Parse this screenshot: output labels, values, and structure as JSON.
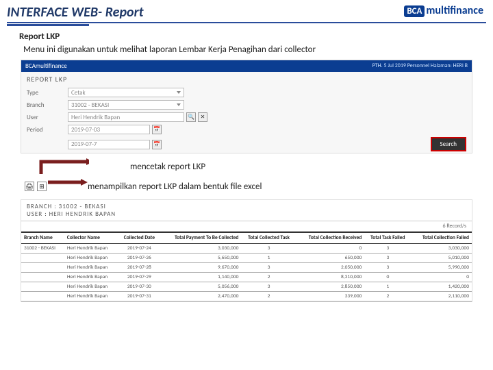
{
  "title": "INTERFACE WEB- Report",
  "logo": {
    "bca": "BCA",
    "multifinance": "multifinance"
  },
  "subtitle": "Report LKP",
  "desc": "Menu ini digunakan untuk melihat laporan Lembar Kerja Penagihan dari collector",
  "shot1": {
    "topbar_brand": "BCAmultifinance",
    "topbar_right": "PTH. 5 Jul 2019\nPersonnel Halaman: HERI B",
    "header": "REPORT LKP",
    "fields": {
      "type_label": "Type",
      "type_value": "Cetak",
      "branch_label": "Branch",
      "branch_value": "31002 - BEKASI",
      "user_label": "User",
      "user_value": "Heri Hendrik Bapan",
      "period_label": "Period",
      "period_from": "2019-07-03",
      "period_to": "2019-07-7"
    },
    "search": "Search"
  },
  "callouts": {
    "c1": "mencetak report LKP",
    "c2": "menampilkan report LKP dalam bentuk file excel"
  },
  "shot2": {
    "branch_line": "BRANCH : 31002 - BEKASI",
    "user_line": "USER : HERI HENDRIK BAPAN",
    "records": "6 Record/s",
    "headers": [
      "Branch Name",
      "Collector Name",
      "Collected Date",
      "Total Payment To Be Collected",
      "Total Collected Task",
      "Total Collection Received",
      "Total Task Failed",
      "Total Collection Failed"
    ],
    "rows": [
      [
        "31002 - BEKASI",
        "Heri Hendrik Bapan",
        "2019-07-24",
        "3,030,000",
        "3",
        "0",
        "3",
        "3,030,000"
      ],
      [
        "",
        "Heri Hendrik Bapan",
        "2019-07-26",
        "5,650,000",
        "1",
        "650,000",
        "3",
        "5,010,000"
      ],
      [
        "",
        "Heri Hendrik Bapan",
        "2019-07-28",
        "9,670,000",
        "3",
        "2,050,000",
        "3",
        "5,990,000"
      ],
      [
        "",
        "Heri Hendrik Bapan",
        "2019-07-29",
        "1,140,000",
        "2",
        "8,310,000",
        "0",
        "0"
      ],
      [
        "",
        "Heri Hendrik Bapan",
        "2019-07-30",
        "5,056,000",
        "3",
        "2,850,000",
        "1",
        "1,420,000"
      ],
      [
        "",
        "Heri Hendrik Bapan",
        "2019-07-31",
        "2,470,000",
        "2",
        "339,000",
        "2",
        "2,110,000"
      ]
    ]
  }
}
